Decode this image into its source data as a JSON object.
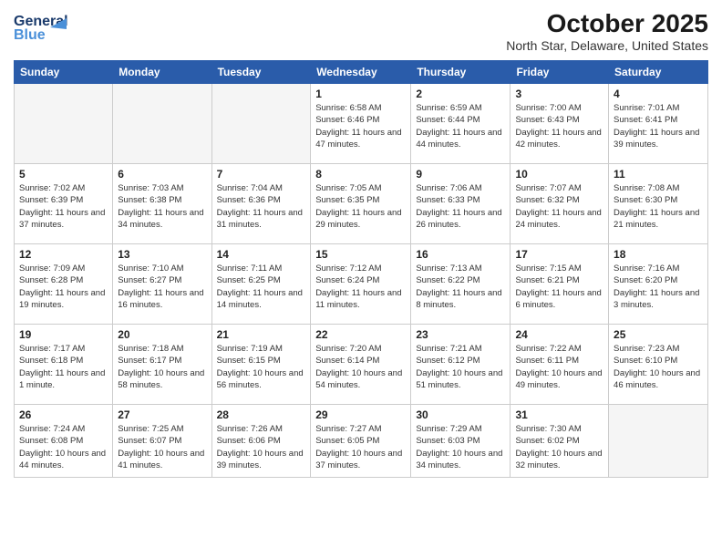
{
  "header": {
    "logo_line1": "General",
    "logo_line2": "Blue",
    "title": "October 2025",
    "subtitle": "North Star, Delaware, United States"
  },
  "calendar": {
    "days_of_week": [
      "Sunday",
      "Monday",
      "Tuesday",
      "Wednesday",
      "Thursday",
      "Friday",
      "Saturday"
    ],
    "weeks": [
      [
        {
          "day": "",
          "info": ""
        },
        {
          "day": "",
          "info": ""
        },
        {
          "day": "",
          "info": ""
        },
        {
          "day": "1",
          "info": "Sunrise: 6:58 AM\nSunset: 6:46 PM\nDaylight: 11 hours\nand 47 minutes."
        },
        {
          "day": "2",
          "info": "Sunrise: 6:59 AM\nSunset: 6:44 PM\nDaylight: 11 hours\nand 44 minutes."
        },
        {
          "day": "3",
          "info": "Sunrise: 7:00 AM\nSunset: 6:43 PM\nDaylight: 11 hours\nand 42 minutes."
        },
        {
          "day": "4",
          "info": "Sunrise: 7:01 AM\nSunset: 6:41 PM\nDaylight: 11 hours\nand 39 minutes."
        }
      ],
      [
        {
          "day": "5",
          "info": "Sunrise: 7:02 AM\nSunset: 6:39 PM\nDaylight: 11 hours\nand 37 minutes."
        },
        {
          "day": "6",
          "info": "Sunrise: 7:03 AM\nSunset: 6:38 PM\nDaylight: 11 hours\nand 34 minutes."
        },
        {
          "day": "7",
          "info": "Sunrise: 7:04 AM\nSunset: 6:36 PM\nDaylight: 11 hours\nand 31 minutes."
        },
        {
          "day": "8",
          "info": "Sunrise: 7:05 AM\nSunset: 6:35 PM\nDaylight: 11 hours\nand 29 minutes."
        },
        {
          "day": "9",
          "info": "Sunrise: 7:06 AM\nSunset: 6:33 PM\nDaylight: 11 hours\nand 26 minutes."
        },
        {
          "day": "10",
          "info": "Sunrise: 7:07 AM\nSunset: 6:32 PM\nDaylight: 11 hours\nand 24 minutes."
        },
        {
          "day": "11",
          "info": "Sunrise: 7:08 AM\nSunset: 6:30 PM\nDaylight: 11 hours\nand 21 minutes."
        }
      ],
      [
        {
          "day": "12",
          "info": "Sunrise: 7:09 AM\nSunset: 6:28 PM\nDaylight: 11 hours\nand 19 minutes."
        },
        {
          "day": "13",
          "info": "Sunrise: 7:10 AM\nSunset: 6:27 PM\nDaylight: 11 hours\nand 16 minutes."
        },
        {
          "day": "14",
          "info": "Sunrise: 7:11 AM\nSunset: 6:25 PM\nDaylight: 11 hours\nand 14 minutes."
        },
        {
          "day": "15",
          "info": "Sunrise: 7:12 AM\nSunset: 6:24 PM\nDaylight: 11 hours\nand 11 minutes."
        },
        {
          "day": "16",
          "info": "Sunrise: 7:13 AM\nSunset: 6:22 PM\nDaylight: 11 hours\nand 8 minutes."
        },
        {
          "day": "17",
          "info": "Sunrise: 7:15 AM\nSunset: 6:21 PM\nDaylight: 11 hours\nand 6 minutes."
        },
        {
          "day": "18",
          "info": "Sunrise: 7:16 AM\nSunset: 6:20 PM\nDaylight: 11 hours\nand 3 minutes."
        }
      ],
      [
        {
          "day": "19",
          "info": "Sunrise: 7:17 AM\nSunset: 6:18 PM\nDaylight: 11 hours\nand 1 minute."
        },
        {
          "day": "20",
          "info": "Sunrise: 7:18 AM\nSunset: 6:17 PM\nDaylight: 10 hours\nand 58 minutes."
        },
        {
          "day": "21",
          "info": "Sunrise: 7:19 AM\nSunset: 6:15 PM\nDaylight: 10 hours\nand 56 minutes."
        },
        {
          "day": "22",
          "info": "Sunrise: 7:20 AM\nSunset: 6:14 PM\nDaylight: 10 hours\nand 54 minutes."
        },
        {
          "day": "23",
          "info": "Sunrise: 7:21 AM\nSunset: 6:12 PM\nDaylight: 10 hours\nand 51 minutes."
        },
        {
          "day": "24",
          "info": "Sunrise: 7:22 AM\nSunset: 6:11 PM\nDaylight: 10 hours\nand 49 minutes."
        },
        {
          "day": "25",
          "info": "Sunrise: 7:23 AM\nSunset: 6:10 PM\nDaylight: 10 hours\nand 46 minutes."
        }
      ],
      [
        {
          "day": "26",
          "info": "Sunrise: 7:24 AM\nSunset: 6:08 PM\nDaylight: 10 hours\nand 44 minutes."
        },
        {
          "day": "27",
          "info": "Sunrise: 7:25 AM\nSunset: 6:07 PM\nDaylight: 10 hours\nand 41 minutes."
        },
        {
          "day": "28",
          "info": "Sunrise: 7:26 AM\nSunset: 6:06 PM\nDaylight: 10 hours\nand 39 minutes."
        },
        {
          "day": "29",
          "info": "Sunrise: 7:27 AM\nSunset: 6:05 PM\nDaylight: 10 hours\nand 37 minutes."
        },
        {
          "day": "30",
          "info": "Sunrise: 7:29 AM\nSunset: 6:03 PM\nDaylight: 10 hours\nand 34 minutes."
        },
        {
          "day": "31",
          "info": "Sunrise: 7:30 AM\nSunset: 6:02 PM\nDaylight: 10 hours\nand 32 minutes."
        },
        {
          "day": "",
          "info": ""
        }
      ]
    ]
  }
}
